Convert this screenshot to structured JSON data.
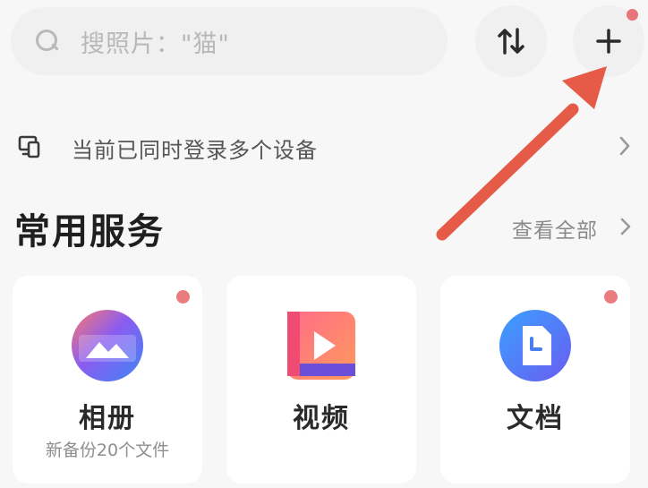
{
  "search": {
    "placeholder": "搜照片：\"猫\""
  },
  "header": {
    "sort_icon": "sort-arrows-icon",
    "add_icon": "plus-icon"
  },
  "device_notice": {
    "text": "当前已同时登录多个设备"
  },
  "section": {
    "title": "常用服务",
    "view_all": "查看全部"
  },
  "services": [
    {
      "name": "相册",
      "subtitle": "新备份20个文件",
      "icon": "album-icon",
      "has_badge": true
    },
    {
      "name": "视频",
      "subtitle": "",
      "icon": "video-icon",
      "has_badge": false
    },
    {
      "name": "文档",
      "subtitle": "",
      "icon": "document-icon",
      "has_badge": true
    }
  ],
  "colors": {
    "badge": "#ea7b7f",
    "annotation_arrow": "#e65a48",
    "background": "#f7f7f7"
  }
}
